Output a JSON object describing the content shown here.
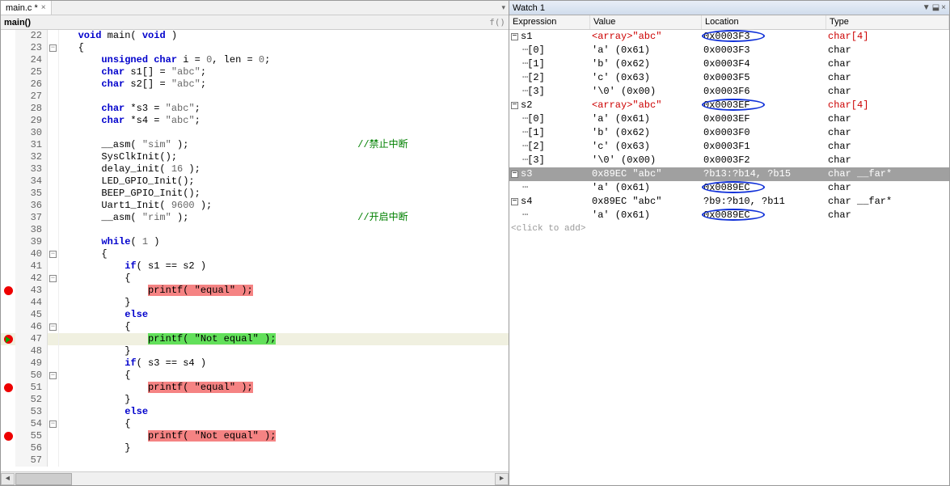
{
  "tab": {
    "label": "main.c *",
    "close": "×"
  },
  "funcbar": {
    "left": "main()",
    "right": "f()"
  },
  "code_lines": [
    {
      "n": 22,
      "fold": "",
      "bp": "",
      "text": [
        {
          "t": "   ",
          "c": ""
        },
        {
          "t": "void",
          "c": "kw"
        },
        {
          "t": " main( ",
          "c": ""
        },
        {
          "t": "void",
          "c": "kw"
        },
        {
          "t": " )",
          "c": ""
        }
      ]
    },
    {
      "n": 23,
      "fold": "⊟",
      "bp": "",
      "text": [
        {
          "t": "   {",
          "c": ""
        }
      ]
    },
    {
      "n": 24,
      "fold": "",
      "bp": "",
      "text": [
        {
          "t": "       ",
          "c": ""
        },
        {
          "t": "unsigned char",
          "c": "kw"
        },
        {
          "t": " i = ",
          "c": ""
        },
        {
          "t": "0",
          "c": "num"
        },
        {
          "t": ", len = ",
          "c": ""
        },
        {
          "t": "0",
          "c": "num"
        },
        {
          "t": ";",
          "c": ""
        }
      ]
    },
    {
      "n": 25,
      "fold": "",
      "bp": "",
      "text": [
        {
          "t": "       ",
          "c": ""
        },
        {
          "t": "char",
          "c": "kw"
        },
        {
          "t": " s1[] = ",
          "c": ""
        },
        {
          "t": "\"abc\"",
          "c": "str"
        },
        {
          "t": ";",
          "c": ""
        }
      ]
    },
    {
      "n": 26,
      "fold": "",
      "bp": "",
      "text": [
        {
          "t": "       ",
          "c": ""
        },
        {
          "t": "char",
          "c": "kw"
        },
        {
          "t": " s2[] = ",
          "c": ""
        },
        {
          "t": "\"abc\"",
          "c": "str"
        },
        {
          "t": ";",
          "c": ""
        }
      ]
    },
    {
      "n": 27,
      "fold": "",
      "bp": "",
      "text": [
        {
          "t": "",
          "c": ""
        }
      ]
    },
    {
      "n": 28,
      "fold": "",
      "bp": "",
      "text": [
        {
          "t": "       ",
          "c": ""
        },
        {
          "t": "char",
          "c": "kw"
        },
        {
          "t": " *s3 = ",
          "c": ""
        },
        {
          "t": "\"abc\"",
          "c": "str"
        },
        {
          "t": ";",
          "c": ""
        }
      ]
    },
    {
      "n": 29,
      "fold": "",
      "bp": "",
      "text": [
        {
          "t": "       ",
          "c": ""
        },
        {
          "t": "char",
          "c": "kw"
        },
        {
          "t": " *s4 = ",
          "c": ""
        },
        {
          "t": "\"abc\"",
          "c": "str"
        },
        {
          "t": ";",
          "c": ""
        }
      ]
    },
    {
      "n": 30,
      "fold": "",
      "bp": "",
      "text": [
        {
          "t": "",
          "c": ""
        }
      ]
    },
    {
      "n": 31,
      "fold": "",
      "bp": "",
      "text": [
        {
          "t": "       __asm( ",
          "c": ""
        },
        {
          "t": "\"sim\"",
          "c": "str"
        },
        {
          "t": " );                             ",
          "c": ""
        },
        {
          "t": "//禁止中断",
          "c": "cmt"
        }
      ]
    },
    {
      "n": 32,
      "fold": "",
      "bp": "",
      "text": [
        {
          "t": "       SysClkInit();",
          "c": ""
        }
      ]
    },
    {
      "n": 33,
      "fold": "",
      "bp": "",
      "text": [
        {
          "t": "       delay_init( ",
          "c": ""
        },
        {
          "t": "16",
          "c": "num"
        },
        {
          "t": " );",
          "c": ""
        }
      ]
    },
    {
      "n": 34,
      "fold": "",
      "bp": "",
      "text": [
        {
          "t": "       LED_GPIO_Init();",
          "c": ""
        }
      ]
    },
    {
      "n": 35,
      "fold": "",
      "bp": "",
      "text": [
        {
          "t": "       BEEP_GPIO_Init();",
          "c": ""
        }
      ]
    },
    {
      "n": 36,
      "fold": "",
      "bp": "",
      "text": [
        {
          "t": "       Uart1_Init( ",
          "c": ""
        },
        {
          "t": "9600",
          "c": "num"
        },
        {
          "t": " );",
          "c": ""
        }
      ]
    },
    {
      "n": 37,
      "fold": "",
      "bp": "",
      "text": [
        {
          "t": "       __asm( ",
          "c": ""
        },
        {
          "t": "\"rim\"",
          "c": "str"
        },
        {
          "t": " );                             ",
          "c": ""
        },
        {
          "t": "//开启中断",
          "c": "cmt"
        }
      ]
    },
    {
      "n": 38,
      "fold": "",
      "bp": "",
      "text": [
        {
          "t": "",
          "c": ""
        }
      ]
    },
    {
      "n": 39,
      "fold": "",
      "bp": "",
      "text": [
        {
          "t": "       ",
          "c": ""
        },
        {
          "t": "while",
          "c": "kw"
        },
        {
          "t": "( ",
          "c": ""
        },
        {
          "t": "1",
          "c": "num"
        },
        {
          "t": " )",
          "c": ""
        }
      ]
    },
    {
      "n": 40,
      "fold": "⊟",
      "bp": "",
      "text": [
        {
          "t": "       {",
          "c": ""
        }
      ]
    },
    {
      "n": 41,
      "fold": "",
      "bp": "",
      "text": [
        {
          "t": "           ",
          "c": ""
        },
        {
          "t": "if",
          "c": "kw"
        },
        {
          "t": "( s1 == s2 )",
          "c": ""
        }
      ]
    },
    {
      "n": 42,
      "fold": "⊟",
      "bp": "",
      "text": [
        {
          "t": "           {",
          "c": ""
        }
      ]
    },
    {
      "n": 43,
      "fold": "",
      "bp": "dot",
      "text": [
        {
          "t": "               ",
          "c": ""
        },
        {
          "t": "printf( \"equal\" );",
          "c": "",
          "hl": "hl-red"
        }
      ]
    },
    {
      "n": 44,
      "fold": "",
      "bp": "",
      "text": [
        {
          "t": "           }",
          "c": ""
        }
      ]
    },
    {
      "n": 45,
      "fold": "",
      "bp": "",
      "text": [
        {
          "t": "           ",
          "c": ""
        },
        {
          "t": "else",
          "c": "kw"
        }
      ]
    },
    {
      "n": 46,
      "fold": "⊟",
      "bp": "",
      "text": [
        {
          "t": "           {",
          "c": ""
        }
      ]
    },
    {
      "n": 47,
      "fold": "",
      "bp": "arrow",
      "current": true,
      "text": [
        {
          "t": "               ",
          "c": ""
        },
        {
          "t": "printf( \"Not equal\" );",
          "c": "",
          "hl": "hl-green"
        }
      ]
    },
    {
      "n": 48,
      "fold": "",
      "bp": "",
      "text": [
        {
          "t": "           }",
          "c": ""
        }
      ]
    },
    {
      "n": 49,
      "fold": "",
      "bp": "",
      "text": [
        {
          "t": "           ",
          "c": ""
        },
        {
          "t": "if",
          "c": "kw"
        },
        {
          "t": "( s3 == s4 )",
          "c": ""
        }
      ]
    },
    {
      "n": 50,
      "fold": "⊟",
      "bp": "",
      "text": [
        {
          "t": "           {",
          "c": ""
        }
      ]
    },
    {
      "n": 51,
      "fold": "",
      "bp": "dot",
      "text": [
        {
          "t": "               ",
          "c": ""
        },
        {
          "t": "printf( \"equal\" );",
          "c": "",
          "hl": "hl-red"
        }
      ]
    },
    {
      "n": 52,
      "fold": "",
      "bp": "",
      "text": [
        {
          "t": "           }",
          "c": ""
        }
      ]
    },
    {
      "n": 53,
      "fold": "",
      "bp": "",
      "text": [
        {
          "t": "           ",
          "c": ""
        },
        {
          "t": "else",
          "c": "kw"
        }
      ]
    },
    {
      "n": 54,
      "fold": "⊟",
      "bp": "",
      "text": [
        {
          "t": "           {",
          "c": ""
        }
      ]
    },
    {
      "n": 55,
      "fold": "",
      "bp": "dot",
      "text": [
        {
          "t": "               ",
          "c": ""
        },
        {
          "t": "printf( \"Not equal\" );",
          "c": "",
          "hl": "hl-red"
        }
      ]
    },
    {
      "n": 56,
      "fold": "",
      "bp": "",
      "text": [
        {
          "t": "           }",
          "c": ""
        }
      ]
    },
    {
      "n": 57,
      "fold": "",
      "bp": "",
      "text": [
        {
          "t": "",
          "c": ""
        }
      ]
    }
  ],
  "watch": {
    "title": "Watch 1",
    "pin": "▼",
    "pushpin": "⬓",
    "close": "×",
    "headers": {
      "expression": "Expression",
      "value": "Value",
      "location": "Location",
      "type": "Type"
    },
    "rows": [
      {
        "indent": 0,
        "toggle": "−",
        "expr": "s1",
        "val": "<array>\"abc\"",
        "loc": "0x0003F3",
        "type": "char[4]",
        "red": true,
        "circle": true
      },
      {
        "indent": 1,
        "toggle": "",
        "expr": "[0]",
        "val": "'a' (0x61)",
        "loc": "0x0003F3",
        "type": "char"
      },
      {
        "indent": 1,
        "toggle": "",
        "expr": "[1]",
        "val": "'b' (0x62)",
        "loc": "0x0003F4",
        "type": "char"
      },
      {
        "indent": 1,
        "toggle": "",
        "expr": "[2]",
        "val": "'c' (0x63)",
        "loc": "0x0003F5",
        "type": "char"
      },
      {
        "indent": 1,
        "toggle": "",
        "expr": "[3]",
        "val": "'\\0' (0x00)",
        "loc": "0x0003F6",
        "type": "char"
      },
      {
        "indent": 0,
        "toggle": "−",
        "expr": "s2",
        "val": "<array>\"abc\"",
        "loc": "0x0003EF",
        "type": "char[4]",
        "red": true,
        "circle": true
      },
      {
        "indent": 1,
        "toggle": "",
        "expr": "[0]",
        "val": "'a' (0x61)",
        "loc": "0x0003EF",
        "type": "char"
      },
      {
        "indent": 1,
        "toggle": "",
        "expr": "[1]",
        "val": "'b' (0x62)",
        "loc": "0x0003F0",
        "type": "char"
      },
      {
        "indent": 1,
        "toggle": "",
        "expr": "[2]",
        "val": "'c' (0x63)",
        "loc": "0x0003F1",
        "type": "char"
      },
      {
        "indent": 1,
        "toggle": "",
        "expr": "[3]",
        "val": "'\\0' (0x00)",
        "loc": "0x0003F2",
        "type": "char"
      },
      {
        "indent": 0,
        "toggle": "−",
        "expr": "s3",
        "val": "0x89EC \"abc\"",
        "loc": "?b13:?b14, ?b15",
        "type": "char __far*",
        "selected": true
      },
      {
        "indent": 1,
        "toggle": "",
        "expr": "",
        "val": "'a' (0x61)",
        "loc": "0x0089EC",
        "type": "char",
        "circle": true
      },
      {
        "indent": 0,
        "toggle": "−",
        "expr": "s4",
        "val": "0x89EC \"abc\"",
        "loc": "?b9:?b10, ?b11",
        "type": "char __far*"
      },
      {
        "indent": 1,
        "toggle": "",
        "expr": "",
        "val": "'a' (0x61)",
        "loc": "0x0089EC",
        "type": "char",
        "circle": true
      }
    ],
    "click_add": "<click to add>"
  }
}
